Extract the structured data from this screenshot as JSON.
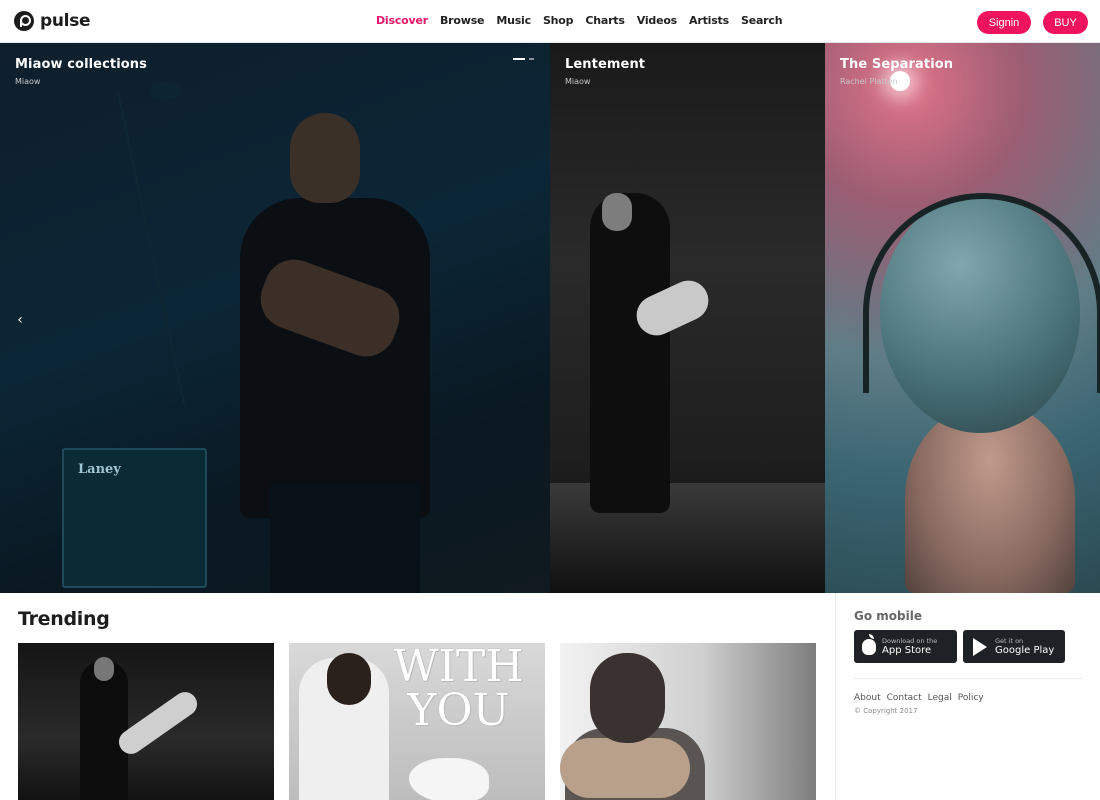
{
  "brand": {
    "name": "pulse",
    "accent": "#e6176a",
    "button_color": "#f0145e"
  },
  "nav": {
    "items": [
      {
        "label": "Discover",
        "active": true
      },
      {
        "label": "Browse",
        "active": false
      },
      {
        "label": "Music",
        "active": false
      },
      {
        "label": "Shop",
        "active": false
      },
      {
        "label": "Charts",
        "active": false
      },
      {
        "label": "Videos",
        "active": false
      },
      {
        "label": "Artists",
        "active": false
      },
      {
        "label": "Search",
        "active": false
      }
    ]
  },
  "header": {
    "signin_label": "Signin",
    "buy_label": "BUY"
  },
  "hero": {
    "prev_icon": "chevron-left-icon",
    "slides": [
      {
        "title": "Miaow collections",
        "subtitle": "Miaow",
        "amp_label": "Laney"
      },
      {
        "title": "Lentement",
        "subtitle": "Miaow"
      },
      {
        "title": "The Separation",
        "subtitle": "Rachel Platten"
      }
    ]
  },
  "trending": {
    "title": "Trending",
    "cards": [
      {
        "art_text": ""
      },
      {
        "art_text_line1": "WITH",
        "art_text_line2": "YOU"
      },
      {
        "art_text": ""
      }
    ]
  },
  "sidebar": {
    "go_mobile": "Go mobile",
    "app_store": {
      "small": "Download on the",
      "big": "App Store",
      "icon": "apple-icon"
    },
    "google_play": {
      "small": "Get it on",
      "big": "Google Play",
      "icon": "play-icon"
    },
    "footer_links": [
      "About",
      "Contact",
      "Legal",
      "Policy"
    ],
    "copyright": "© Copyright 2017"
  }
}
